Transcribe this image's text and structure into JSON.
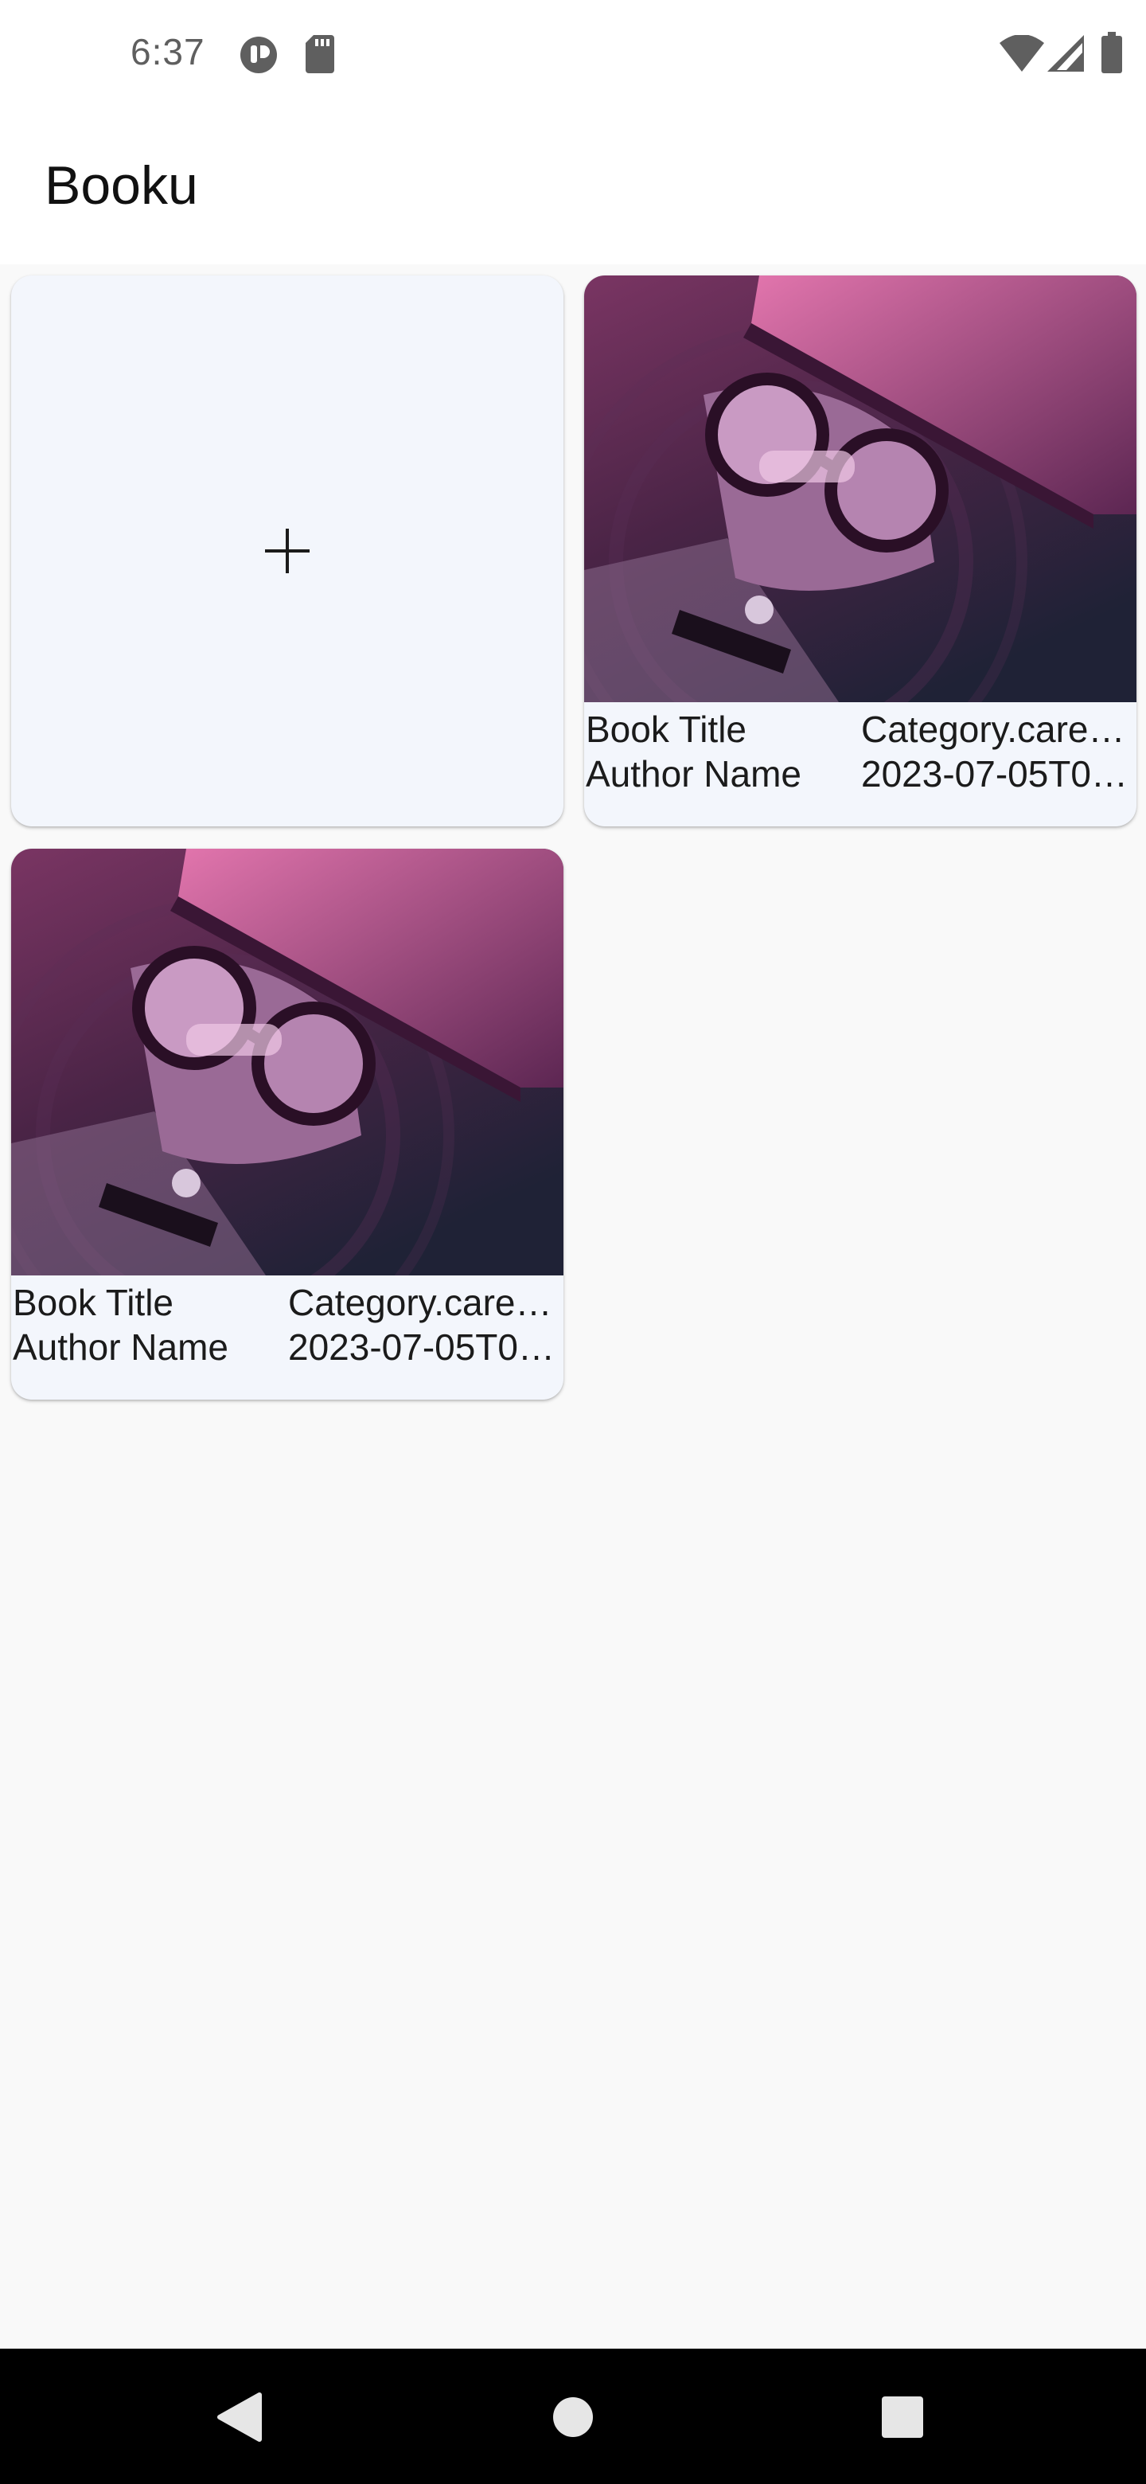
{
  "status_bar": {
    "time": "6:37",
    "left_icons": [
      "podcast-icon",
      "sd-card-icon"
    ],
    "right_icons": [
      "wifi-icon",
      "cellular-signal-icon",
      "battery-icon"
    ]
  },
  "app_bar": {
    "title": "Booku"
  },
  "add_card": {
    "icon": "plus-icon",
    "label": "+"
  },
  "books": [
    {
      "title": "Book Title",
      "author": "Author Name",
      "category": "Category.care…",
      "date": "2023-07-05T0…",
      "cover": "robot-reading-illustration"
    },
    {
      "title": "Book Title",
      "author": "Author Name",
      "category": "Category.care…",
      "date": "2023-07-05T0…",
      "cover": "robot-reading-illustration"
    }
  ],
  "nav_bar": {
    "buttons": [
      "back-icon",
      "home-icon",
      "recents-icon"
    ]
  },
  "colors": {
    "card_bg": "#f3f6fc",
    "page_bg": "#f9f9f9",
    "cover_dark": "#2a1f3a",
    "cover_pink": "#c2588f"
  }
}
